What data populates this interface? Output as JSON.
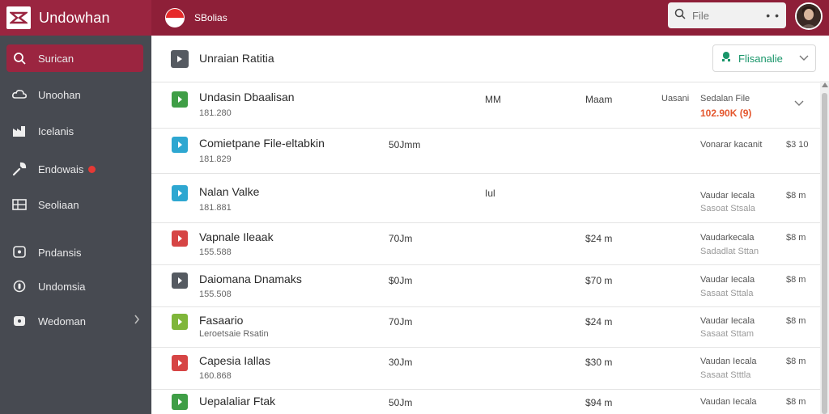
{
  "topbar": {
    "app_title": "Undowhan",
    "app_name": "SBolias",
    "search_placeholder": "File",
    "search_more": "• •",
    "avatar_icon": "user-avatar"
  },
  "sidebar": {
    "items": [
      {
        "label": "Surican",
        "icon": "search-icon",
        "active": true
      },
      {
        "label": "Unoohan",
        "icon": "cloud-icon"
      },
      {
        "label": "Icelanis",
        "icon": "factory-icon"
      },
      {
        "label": "Endowais",
        "icon": "wrench-icon",
        "badge": true
      },
      {
        "label": "Seoliaan",
        "icon": "grid-icon"
      },
      {
        "label": "Pndansis",
        "icon": "chat-icon"
      },
      {
        "label": "Undomsia",
        "icon": "coin-icon"
      },
      {
        "label": "Wedoman",
        "icon": "chat-icon",
        "chevron": true
      }
    ]
  },
  "main": {
    "header_title": "Unraian Ratitia",
    "filter_label": "Flisanalie"
  },
  "rows": [
    {
      "name": "Undasin Dbaalisan",
      "sub": "181.280",
      "color": "#3f9e46",
      "c1": "",
      "c2": "MM",
      "c3": "Maam",
      "c4": "Uasani",
      "right_top": "Sedalan File",
      "right_accent": "102.90K (9)",
      "has_chevron": true
    },
    {
      "name": "Comietpane File-eltabkin",
      "sub": "181.829",
      "color": "#2ea7d1",
      "c1": "50Jmm",
      "c2": "",
      "c3": "",
      "c4": "",
      "right_top": "Vonarar kacanit",
      "right_bottom": "",
      "amount": "$3 10"
    },
    {
      "name": "Nalan Valke",
      "sub": "181.881",
      "color": "#2ea7d1",
      "c1": "",
      "c2": "Iul",
      "c3": "",
      "c4": "",
      "right_top": "Vaudar Iecala",
      "right_bottom": "Sasoat Stsala",
      "amount": "$8 m"
    },
    {
      "name": "Vapnale Ileaak",
      "sub": "155.588",
      "color": "#d64545",
      "c1": "70Jm",
      "c2": "",
      "c3": "$24 m",
      "c4": "",
      "right_top": "Vaudarkecala",
      "right_bottom": "Sadadlat Sttan",
      "amount": "$8 m"
    },
    {
      "name": "Daiomana Dnamaks",
      "sub": "155.508",
      "color": "#555a61",
      "c1": "$0Jm",
      "c2": "",
      "c3": "$70 m",
      "c4": "",
      "right_top": "Vaudar Iecala",
      "right_bottom": "Sasaat Sttala",
      "amount": "$8 m"
    },
    {
      "name": "Fasaario",
      "sub": "Leroetsaie Rsatin",
      "color": "#7fb63a",
      "c1": "70Jm",
      "c2": "",
      "c3": "$24 m",
      "c4": "",
      "right_top": "Vaudar Iecala",
      "right_bottom": "Sasaat Sttam",
      "amount": "$8 m"
    },
    {
      "name": "Capesia Iallas",
      "sub": "160.868",
      "color": "#d64545",
      "c1": "30Jm",
      "c2": "",
      "c3": "$30 m",
      "c4": "",
      "right_top": "Vaudan Iecala",
      "right_bottom": "Sasaat Stttla",
      "amount": "$8 m"
    },
    {
      "name": "Uepalaliar Ftak",
      "sub": "",
      "color": "#3f9e46",
      "c1": "50Jm",
      "c2": "",
      "c3": "$94 m",
      "c4": "",
      "right_top": "Vaudan Iecala",
      "right_bottom": "",
      "amount": "$8 m"
    }
  ]
}
